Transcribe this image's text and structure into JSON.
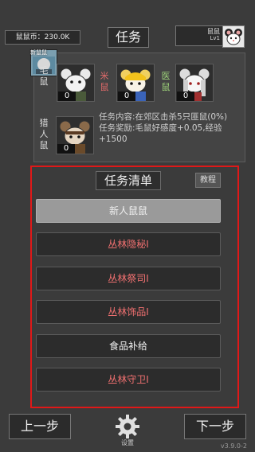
{
  "header": {
    "currency": "鼠鼠币：230.0K",
    "title": "任务",
    "player_name": "鼠鼠",
    "player_level": "Lv1"
  },
  "team": {
    "badge_label": "新鼠鼠",
    "members": [
      {
        "role": "毛鼠",
        "count": "0"
      },
      {
        "role": "米鼠",
        "count": "0"
      },
      {
        "role": "医鼠",
        "count": "0"
      }
    ],
    "hunter": {
      "role": "猎人鼠",
      "count": "0"
    },
    "quest_description": "任务内容:在郊区击杀5只匪鼠(0%)",
    "quest_reward": "任务奖励:毛鼠好感度+0.05,经验+1500"
  },
  "tasks": {
    "header": "任务清单",
    "tutorial_label": "教程",
    "items": [
      {
        "label": "新人鼠鼠"
      },
      {
        "label": "丛林隐秘I"
      },
      {
        "label": "丛林祭司I"
      },
      {
        "label": "丛林饰品I"
      },
      {
        "label": "食品补给"
      },
      {
        "label": "丛林守卫I"
      }
    ]
  },
  "footer": {
    "prev_label": "上一步",
    "next_label": "下一步",
    "settings_label": "设置",
    "version": "v3.9.0-2"
  }
}
